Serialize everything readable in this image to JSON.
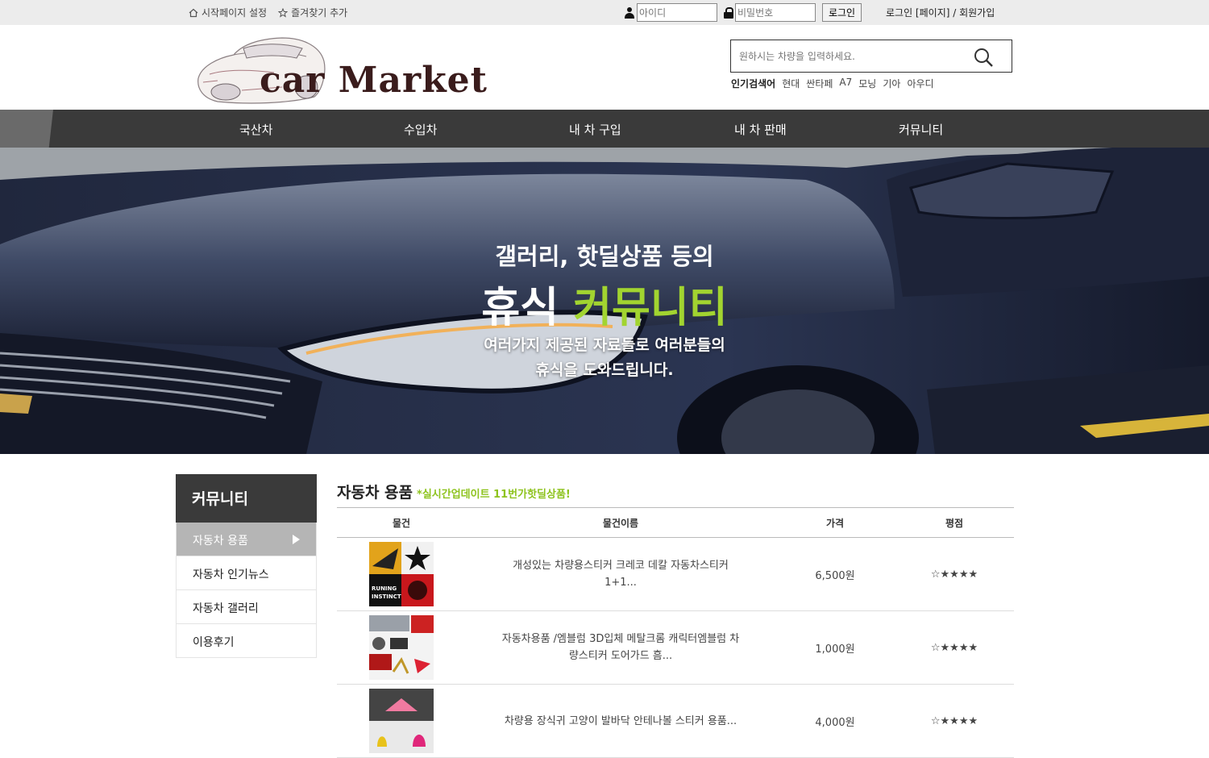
{
  "topbar": {
    "home_label": "시작페이지 설정",
    "bookmark_label": "즐겨찾기 추가",
    "id_placeholder": "아이디",
    "pw_placeholder": "비밀번호",
    "login_button": "로그인",
    "right_links": "로그인 [페이지] /  회원가입"
  },
  "header": {
    "logo_text": "car Market",
    "search_placeholder": "원하시는 차량을 입력하세요.",
    "popular_label": "인기검색어",
    "popular_terms": [
      "현대",
      "싼타페",
      "A7",
      "모닝",
      "기아",
      "아우디"
    ]
  },
  "nav": {
    "items": [
      "국산차",
      "수입차",
      "내 차 구입",
      "내 차 판매",
      "커뮤니티"
    ]
  },
  "hero": {
    "line1": "갤러리, 핫딜상품 등의",
    "line2_white": "휴식",
    "line2_accent": "커뮤니티",
    "line3": "여러가지 제공된 자료들로 여러분들의",
    "line4": "휴식을 도와드립니다."
  },
  "sidebar": {
    "title": "커뮤니티",
    "items": [
      "자동차 용품",
      "자동차 인기뉴스",
      "자동차 갤러리",
      "이용후기"
    ]
  },
  "content": {
    "title": "자동차 용품",
    "subtitle": "*실시간업데이트 11번가핫딜상품!",
    "columns": [
      "물건",
      "물건이름",
      "가격",
      "평점"
    ],
    "rows": [
      {
        "name": "개성있는 차량용스티커 크레코 데칼 자동차스티커 1+1...",
        "price": "6,500원",
        "rating": "☆★★★★"
      },
      {
        "name": "자동차용품 /엠블럼 3D입체 메탈크롬 캐릭터엠블럼 차량스티커 도어가드 흠...",
        "price": "1,000원",
        "rating": "☆★★★★"
      },
      {
        "name": "차량용 장식귀 고양이 발바닥 안테나볼 스티커 용품...",
        "price": "4,000원",
        "rating": "☆★★★★"
      }
    ]
  },
  "colors": {
    "accent": "#a2d430",
    "nav_bg": "#3a3a3a",
    "subtitle": "#8ec31e"
  },
  "icons": [
    "home-icon",
    "star-icon",
    "person-icon",
    "lock-icon",
    "search-icon",
    "play-arrow-icon"
  ]
}
